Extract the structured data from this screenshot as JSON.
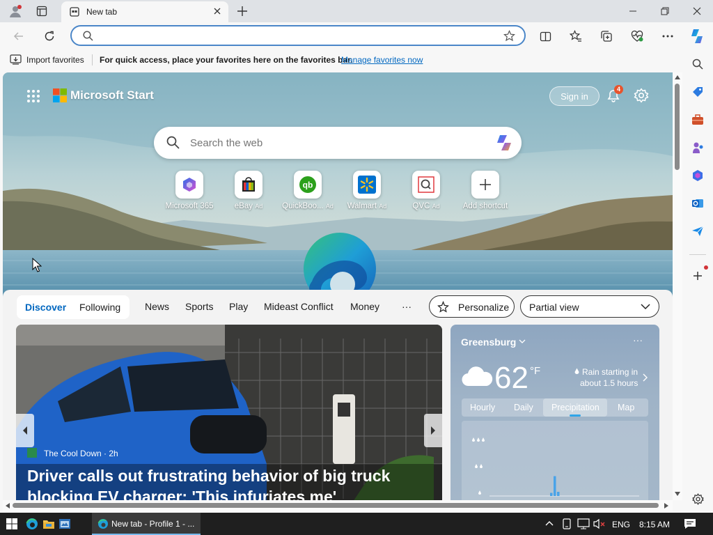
{
  "colors": {
    "accent": "#0067c0",
    "address_border": "#4a86c8",
    "taskbar": "#1f1f1f",
    "badge": "#e8542c"
  },
  "window": {
    "tab_title": "New tab",
    "minimize_icon": "minimize-icon",
    "maximize_icon": "restore-icon",
    "close_icon": "close-icon"
  },
  "address": {
    "value": "",
    "placeholder": ""
  },
  "favorites_bar": {
    "import_label": "Import favorites",
    "message": "For quick access, place your favorites here on the favorites bar.",
    "manage_link": "Manage favorites now"
  },
  "header": {
    "brand": "Microsoft Start",
    "sign_in": "Sign in",
    "notification_count": "4"
  },
  "search": {
    "placeholder": "Search the web"
  },
  "quick_links": [
    {
      "label": "Microsoft 365",
      "ad": ""
    },
    {
      "label": "eBay",
      "ad": "Ad"
    },
    {
      "label": "QuickBoo...",
      "ad": "Ad"
    },
    {
      "label": "Walmart",
      "ad": "Ad"
    },
    {
      "label": "QVC",
      "ad": "Ad"
    },
    {
      "label": "Add shortcut",
      "ad": ""
    }
  ],
  "feed_nav": {
    "discover": "Discover",
    "following": "Following",
    "items": [
      "News",
      "Sports",
      "Play",
      "Mideast Conflict",
      "Money"
    ],
    "more": "···",
    "personalize": "Personalize",
    "view_select": "Partial view"
  },
  "article": {
    "source": "The Cool Down · 2h",
    "headline": "Driver calls out frustrating behavior of big truck blocking EV charger: 'This infuriates me'"
  },
  "weather": {
    "location": "Greensburg",
    "more": "···",
    "temp": "62",
    "unit": "°F",
    "condition_line1": "Rain starting in",
    "condition_line2": "about 1.5 hours",
    "tabs": [
      "Hourly",
      "Daily",
      "Precipitation",
      "Map"
    ],
    "active_tab": "Precipitation",
    "precip_levels": [
      0.15,
      0.95,
      0.2
    ]
  },
  "taskbar": {
    "app_label": "New tab - Profile 1 - ...",
    "lang": "ENG",
    "time": "8:15 AM"
  }
}
